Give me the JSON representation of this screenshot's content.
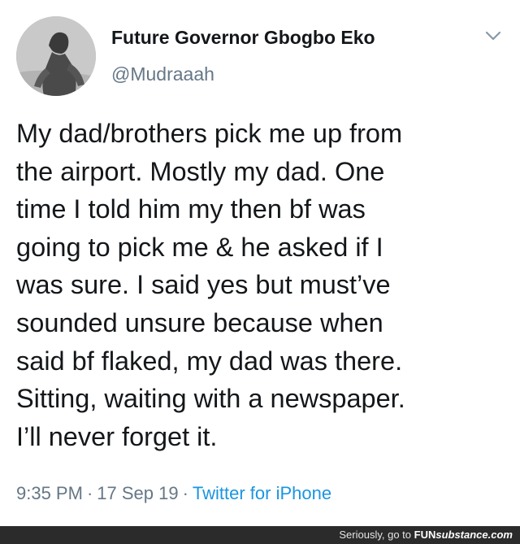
{
  "author": {
    "display_name": "Future Governor Gbogbo Eko",
    "handle": "@Mudraaah",
    "avatar_icon": "profile-photo"
  },
  "tweet": {
    "text_lines": [
      "My dad/brothers pick me up from",
      "the airport. Mostly my dad. One",
      "time I told him my then bf was",
      "going to pick me & he asked if I",
      "was sure. I said yes but must’ve",
      "sounded unsure because when",
      "said bf flaked, my dad was there.",
      "Sitting, waiting with a newspaper.",
      "I’ll never forget it."
    ]
  },
  "meta": {
    "time": "9:35 PM",
    "separator": "·",
    "date": "17 Sep 19",
    "source": "Twitter for iPhone"
  },
  "menu": {
    "caret_icon": "chevron-down-icon"
  },
  "watermark": {
    "prefix": "Seriously, go to ",
    "brand_bold": "FUN",
    "brand_rest": "substance.com"
  },
  "colors": {
    "text": "#14171a",
    "muted": "#657786",
    "link": "#1b95e0",
    "watermark_bg": "#2b2b2b"
  }
}
